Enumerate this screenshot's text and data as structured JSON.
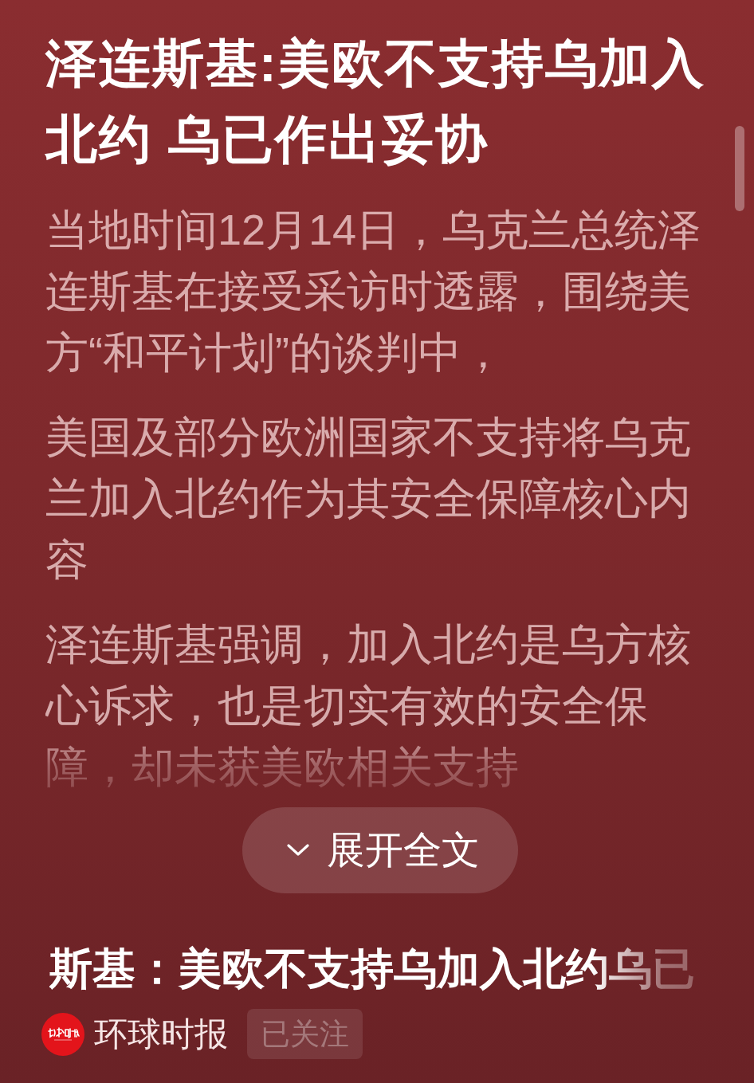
{
  "article": {
    "title": "泽连斯基:美欧不支持乌加入北约 乌已作出妥协",
    "paragraphs": [
      "当地时间12月14日，乌克兰总统泽连斯基在接受采访时透露，围绕美方“和平计划”的谈判中，",
      "美国及部分欧洲国家不支持将乌克兰加入北约作为其安全保障核心内容",
      "泽连斯基强调，加入北约是乌方核心诉求，也是切实有效的安全保障，却未获美欧相关支持"
    ],
    "expand_button": {
      "label": "展开全文"
    }
  },
  "marquee_title": "斯基：美欧不支持乌加入北约乌已",
  "source": {
    "name": "环球时报",
    "follow_button": {
      "label": "已关注",
      "following": true
    }
  }
}
